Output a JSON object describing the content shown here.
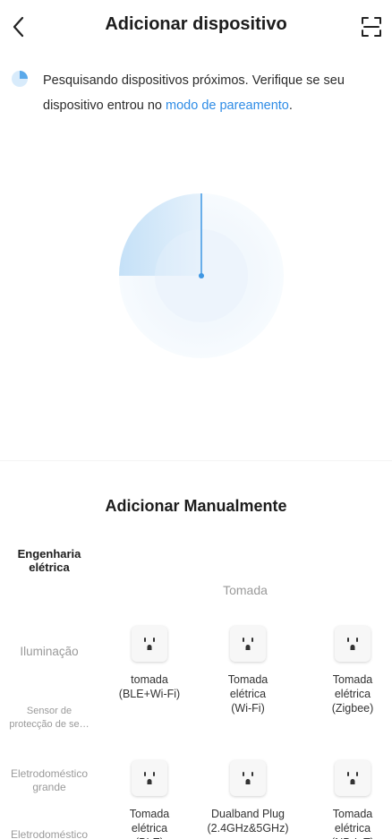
{
  "header": {
    "title": "Adicionar dispositivo"
  },
  "notice": {
    "text": "Pesquisando dispositivos próximos. Verifique se seu dispositivo entrou no ",
    "link": "modo de pareamento",
    "suffix": "."
  },
  "manual": {
    "title": "Adicionar Manualmente",
    "category_label": "Tomada"
  },
  "sidebar": {
    "items": [
      {
        "label": "Engenharia\nelétrica"
      },
      {
        "label": "Iluminação"
      },
      {
        "label": "Sensor de\nprotecção de se…"
      },
      {
        "label": "Eletrodoméstico\ngrande"
      },
      {
        "label": "Eletrodoméstico"
      }
    ]
  },
  "devices": [
    {
      "name": "tomada\n(BLE+Wi-Fi)"
    },
    {
      "name": "Tomada\nelétrica\n(Wi-Fi)"
    },
    {
      "name": "Tomada\nelétrica\n(Zigbee)"
    },
    {
      "name": "Tomada\nelétrica\n(BLE)"
    },
    {
      "name": "Dualband Plug\n(2.4GHz&5GHz)"
    },
    {
      "name": "Tomada\nelétrica\n(NB-IoT)"
    }
  ],
  "colors": {
    "accent": "#2e8ce6",
    "radar": "#5aa9ea"
  }
}
